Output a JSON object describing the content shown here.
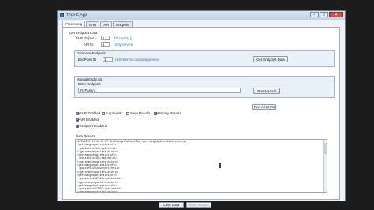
{
  "window": {
    "title": "TAOHC App"
  },
  "window_buttons": {
    "minimize": "–",
    "maximize": "□",
    "close": "✕"
  },
  "tabs": [
    {
      "label": "Processing"
    },
    {
      "label": "EHR"
    },
    {
      "label": "API"
    },
    {
      "label": "Endpoint"
    }
  ],
  "get_endpoint": {
    "group_label": "Get Endpoint Data",
    "ehr_id_label": "EHR ID (set.)",
    "ehr_id_value": "1",
    "ehr_id_link": "Allscripts(1)",
    "api_id_label": "API ID",
    "api_id_value": "1",
    "api_id_link": "UnityService"
  },
  "db_endpoint": {
    "group_label": "Database Endpoint",
    "endpoint_id_label": "EndPoint ID",
    "endpoint_id_value": "1",
    "endpoint_link": "UnityService.svc/unityservice",
    "button": "Get Endpoint Data"
  },
  "manual_endpoint": {
    "group_label": "Manual Endpoint",
    "enter_label": "Enter Endpoint",
    "value": "/RxPatient",
    "button": "Run Manual"
  },
  "run_all_button": "Run All EHRs",
  "options": [
    {
      "label": "EHR Enabled",
      "checked": true
    },
    {
      "label": "Log Events",
      "checked": false
    },
    {
      "label": "Save Results",
      "checked": false
    },
    {
      "label": "Display Results",
      "checked": true
    },
    {
      "label": "API Enabled",
      "checked": true
    },
    {
      "label": "Endpoint Enabled",
      "checked": true
    }
  ],
  "results": {
    "label": "Data Results",
    "lines": [
      "12/8/2015 11:14:21 PM GetChangedPatientIds <getchangedpatientidsresponse>",
      "<getchangedpatientidsinfo>",
      "<patientid>31</patientid>",
      "</getchangedpatientidsinfo>",
      "<getchangedpatientidsinfo>",
      "<patientid>48</patientid>",
      "</getchangedpatientidsinfo>",
      "<getchangedpatientidsinfo>",
      "<patientid>5699</patientid>",
      "</getchangedpatientidsinfo>",
      "<getchangedpatientidsinfo>",
      "<patientid>67004</patientid>",
      "</getchangedpatientidsinfo>",
      "<getchangedpatientidsinfo>",
      "<patientid>67009</patientid>",
      "</getchangedpatientidsinfo>",
      "<getchangedpatientidsinfo>",
      "<patientid>67078</patientid>"
    ]
  },
  "bottom": {
    "clear": "Clear Data",
    "save": "Save Results"
  }
}
